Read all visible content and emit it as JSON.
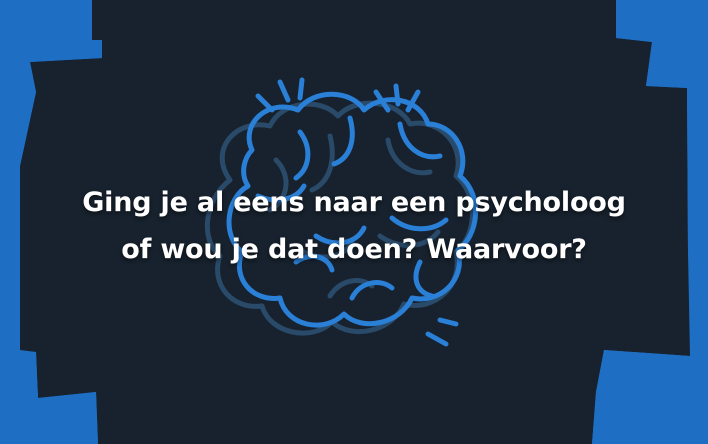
{
  "card": {
    "question_line1": "Ging je al eens naar een psycholoog",
    "question_line2": "of wou je dat doen? Waarvoor?",
    "illustration_icon": "brain-icon"
  },
  "colors": {
    "accent_blue": "#1e6fc4",
    "panel_dark": "#17222e",
    "brain_bright": "#2a7fd6",
    "brain_dim": "#2a4a6a",
    "text": "#ffffff"
  }
}
